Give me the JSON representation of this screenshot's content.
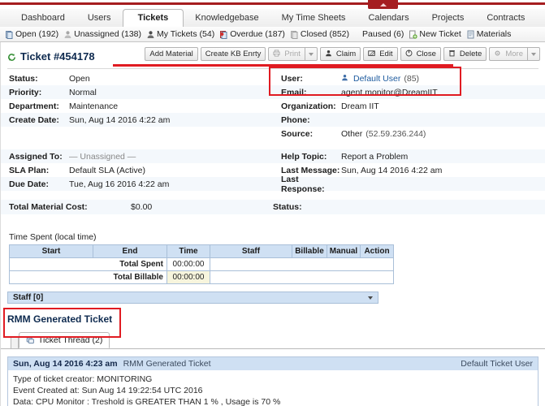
{
  "topbar": {
    "collapse_label": "collapse-panel"
  },
  "nav": {
    "tabs": [
      {
        "label": "Dashboard",
        "active": false
      },
      {
        "label": "Users",
        "active": false
      },
      {
        "label": "Tickets",
        "active": true
      },
      {
        "label": "Knowledgebase",
        "active": false
      },
      {
        "label": "My Time Sheets",
        "active": false
      },
      {
        "label": "Calendars",
        "active": false
      },
      {
        "label": "Projects",
        "active": false
      },
      {
        "label": "Contracts",
        "active": false
      }
    ]
  },
  "subnav": {
    "items": [
      {
        "label": "Open (192)",
        "icon": "ticket-icon"
      },
      {
        "label": "Unassigned (138)",
        "icon": "user-gray-icon"
      },
      {
        "label": "My Tickets (54)",
        "icon": "user-dark-icon"
      },
      {
        "label": "Overdue (187)",
        "icon": "ticket-red-icon"
      },
      {
        "label": "Closed (852)",
        "icon": "ticket-closed-icon"
      },
      {
        "label": "Paused (6)",
        "icon": "none"
      },
      {
        "label": "New Ticket",
        "icon": "new-ticket-icon"
      },
      {
        "label": "Materials",
        "icon": "materials-icon"
      }
    ]
  },
  "ticket": {
    "title": "Ticket #454178",
    "refresh_icon": "refresh-icon"
  },
  "toolbar": {
    "add_material": "Add Material",
    "create_kb_entry": "Create KB Enrty",
    "print": "Print",
    "claim": "Claim",
    "edit": "Edit",
    "close": "Close",
    "delete": "Delete",
    "more": "More"
  },
  "details": {
    "left": [
      {
        "key": "Status:",
        "value": "Open"
      },
      {
        "key": "Priority:",
        "value": "Normal"
      },
      {
        "key": "Department:",
        "value": "Maintenance"
      },
      {
        "key": "Create Date:",
        "value": "Sun, Aug 14 2016 4:22 am"
      }
    ],
    "right": [
      {
        "key": "User:",
        "value": "Default User",
        "extra": "(85)",
        "link": true,
        "icon": "user-blue-icon"
      },
      {
        "key": "Email:",
        "value": "agent.monitor@DreamIIT",
        "extra": "",
        "link": false,
        "icon": "none"
      },
      {
        "key": "Organization:",
        "value": "Dream IIT",
        "extra": "",
        "link": false,
        "icon": "none"
      },
      {
        "key": "Phone:",
        "value": "",
        "extra": "",
        "link": false,
        "icon": "none"
      },
      {
        "key": "Source:",
        "value": "Other",
        "extra": "(52.59.236.244)",
        "link": false,
        "icon": "none"
      }
    ],
    "left2": [
      {
        "key": "Assigned To:",
        "value": "— Unassigned —",
        "muted": true
      },
      {
        "key": "SLA Plan:",
        "value": "Default SLA (Active)",
        "muted": false
      },
      {
        "key": "Due Date:",
        "value": "Tue, Aug 16 2016 4:22 am",
        "muted": false
      }
    ],
    "right2": [
      {
        "key": "Help Topic:",
        "value": "Report a Problem",
        "muted": false
      },
      {
        "key": "Last Message:",
        "value": "Sun, Aug 14 2016 4:22 am",
        "muted": false
      },
      {
        "key": "Last Response:",
        "value": "",
        "muted": false
      }
    ],
    "cost": {
      "label": "Total Material Cost:",
      "amount": "$0.00",
      "status_label": "Status:",
      "status_value": ""
    }
  },
  "time_spent": {
    "caption": "Time Spent (local time)",
    "columns": [
      "Start",
      "End",
      "Time",
      "Staff",
      "Billable",
      "Manual",
      "Action"
    ],
    "rows": [
      {
        "label": "Total Spent",
        "value": "00:00:00"
      },
      {
        "label": "Total Billable",
        "value": "00:00:00"
      }
    ]
  },
  "staff_panel": {
    "label": "Staff [0]",
    "icon": "chevron-down-icon"
  },
  "subject": "RMM Generated Ticket",
  "thread_tabs": [
    {
      "label": "Ticket Thread (2)",
      "icon": "thread-icon",
      "active": true
    }
  ],
  "thread_entry": {
    "timestamp": "Sun, Aug 14 2016 4:23 am",
    "subject": "RMM Generated Ticket",
    "author": "Default Ticket User",
    "body": [
      "Type of ticket creator: MONITORING",
      "Event Created at: Sun Aug 14 19:22:54 UTC 2016",
      "Data: CPU Monitor : Treshold is GREATER THAN 1 % , Usage is 70 %"
    ]
  },
  "colors": {
    "accent_red": "#e01b22",
    "brand_red": "#a51d20",
    "header_blue": "#cfe0f3",
    "link_blue": "#1c5a9e",
    "title_navy": "#0e2a4f"
  }
}
